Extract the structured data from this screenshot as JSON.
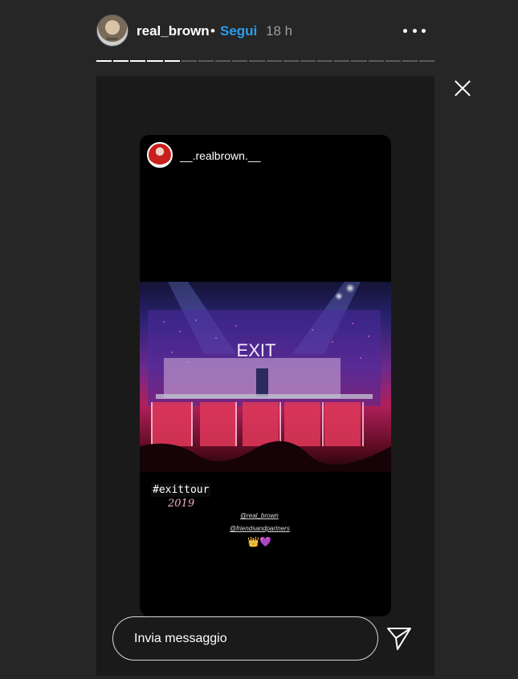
{
  "header": {
    "username": "real_brown",
    "separator": "•",
    "follow_label": "Segui",
    "time": "18 h",
    "avatar_text": "brown"
  },
  "progress": {
    "total_segments": 20,
    "completed_segments": 5
  },
  "story": {
    "shared_user": "__.realbrown.__",
    "photo_sign": "EXIT",
    "hashtag": "#exittour",
    "year": "2019",
    "mention_1": "@real_brown",
    "mention_2": "@friendsandpartners",
    "emoji": "👑💜"
  },
  "reply": {
    "placeholder": "Invia messaggio"
  },
  "icons": {
    "more": "more-horizontal-icon",
    "close": "close-icon",
    "send": "send-icon"
  },
  "colors": {
    "background": "#262626",
    "follow_accent": "#2b9cf0",
    "progress_done": "#ffffff",
    "progress_pending": "#5a5a5a"
  }
}
